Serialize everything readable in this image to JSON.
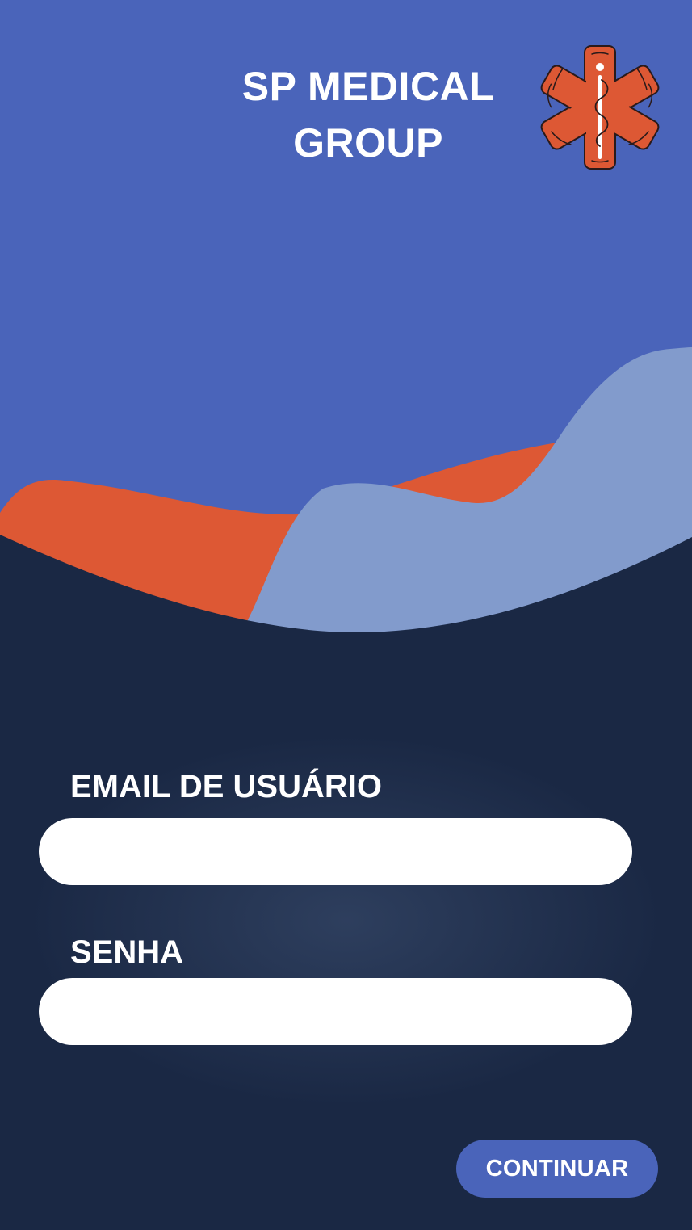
{
  "header": {
    "title_line1": "SP MEDICAL",
    "title_line2": "GROUP",
    "logo_icon": "star-of-life-icon"
  },
  "form": {
    "email_label": "EMAIL DE USUÁRIO",
    "email_value": "",
    "password_label": "SENHA",
    "password_value": ""
  },
  "actions": {
    "continue_label": "CONTINUAR"
  },
  "colors": {
    "primary_blue": "#4a64ba",
    "accent_orange": "#dd5834",
    "light_blue": "#829bcc",
    "dark_navy": "#1a2844",
    "white": "#ffffff"
  }
}
